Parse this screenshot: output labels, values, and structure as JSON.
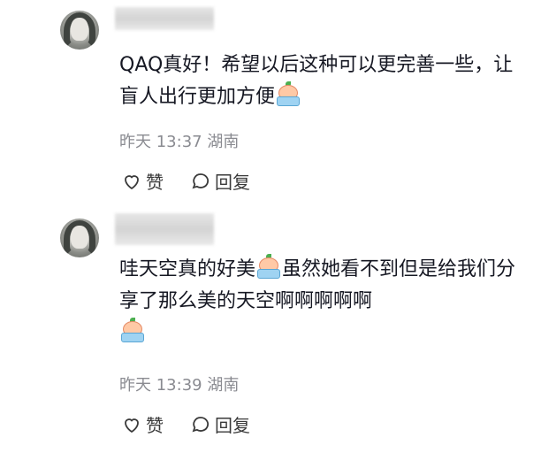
{
  "comments": [
    {
      "text_parts": [
        "QAQ真好！希望以后这种可以更完善一些，让盲人出行更加方便"
      ],
      "emoji": "crying-emoji",
      "time": "昨天 13:37",
      "location": "湖南",
      "like_label": "赞",
      "reply_label": "回复"
    },
    {
      "text_parts": [
        "哇天空真的好美",
        "虽然她看不到但是给我们分享了那么美的天空啊啊啊啊啊"
      ],
      "emoji": "crying-emoji",
      "time": "昨天 13:39",
      "location": "湖南",
      "like_label": "赞",
      "reply_label": "回复"
    }
  ]
}
